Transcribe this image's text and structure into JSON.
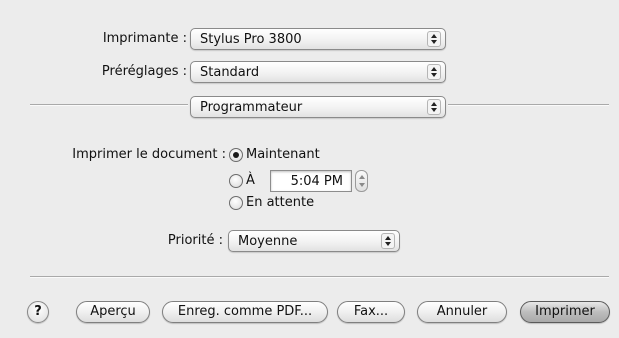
{
  "printer": {
    "label": "Imprimante :",
    "value": "Stylus Pro 3800"
  },
  "presets": {
    "label": "Préréglages :",
    "value": "Standard"
  },
  "panel": {
    "value": "Programmateur"
  },
  "print_document": {
    "label": "Imprimer le document :",
    "options": [
      {
        "label": "Maintenant",
        "selected": true
      },
      {
        "label": "À",
        "selected": false
      },
      {
        "label": "En attente",
        "selected": false
      }
    ],
    "time": "5:04 PM"
  },
  "priority": {
    "label": "Priorité :",
    "value": "Moyenne"
  },
  "buttons": {
    "help": "?",
    "preview": "Aperçu",
    "save_pdf": "Enreg. comme PDF...",
    "fax": "Fax...",
    "cancel": "Annuler",
    "print": "Imprimer"
  }
}
